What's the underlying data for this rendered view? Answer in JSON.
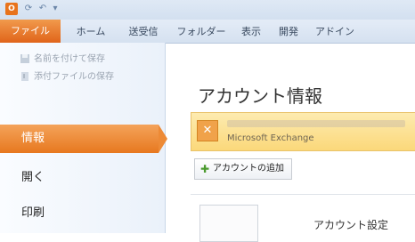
{
  "ribbon": {
    "tabs": [
      "ファイル",
      "ホーム",
      "送受信",
      "フォルダー",
      "表示",
      "開発",
      "アドイン"
    ]
  },
  "backstage_nav": {
    "commands": [
      "名前を付けて保存",
      "添付ファイルの保存"
    ],
    "items": [
      {
        "label": "情報",
        "active": true
      },
      {
        "label": "開く",
        "active": false
      },
      {
        "label": "印刷",
        "active": false
      }
    ]
  },
  "main": {
    "title": "アカウント情報",
    "account": {
      "type": "Microsoft Exchange"
    },
    "add_account_label": "アカウントの追加",
    "account_settings_label": "アカウント設定"
  },
  "colors": {
    "file_tab": "#e0641a",
    "active_nav": "#e7781f",
    "account_highlight": "#fbd87a"
  }
}
